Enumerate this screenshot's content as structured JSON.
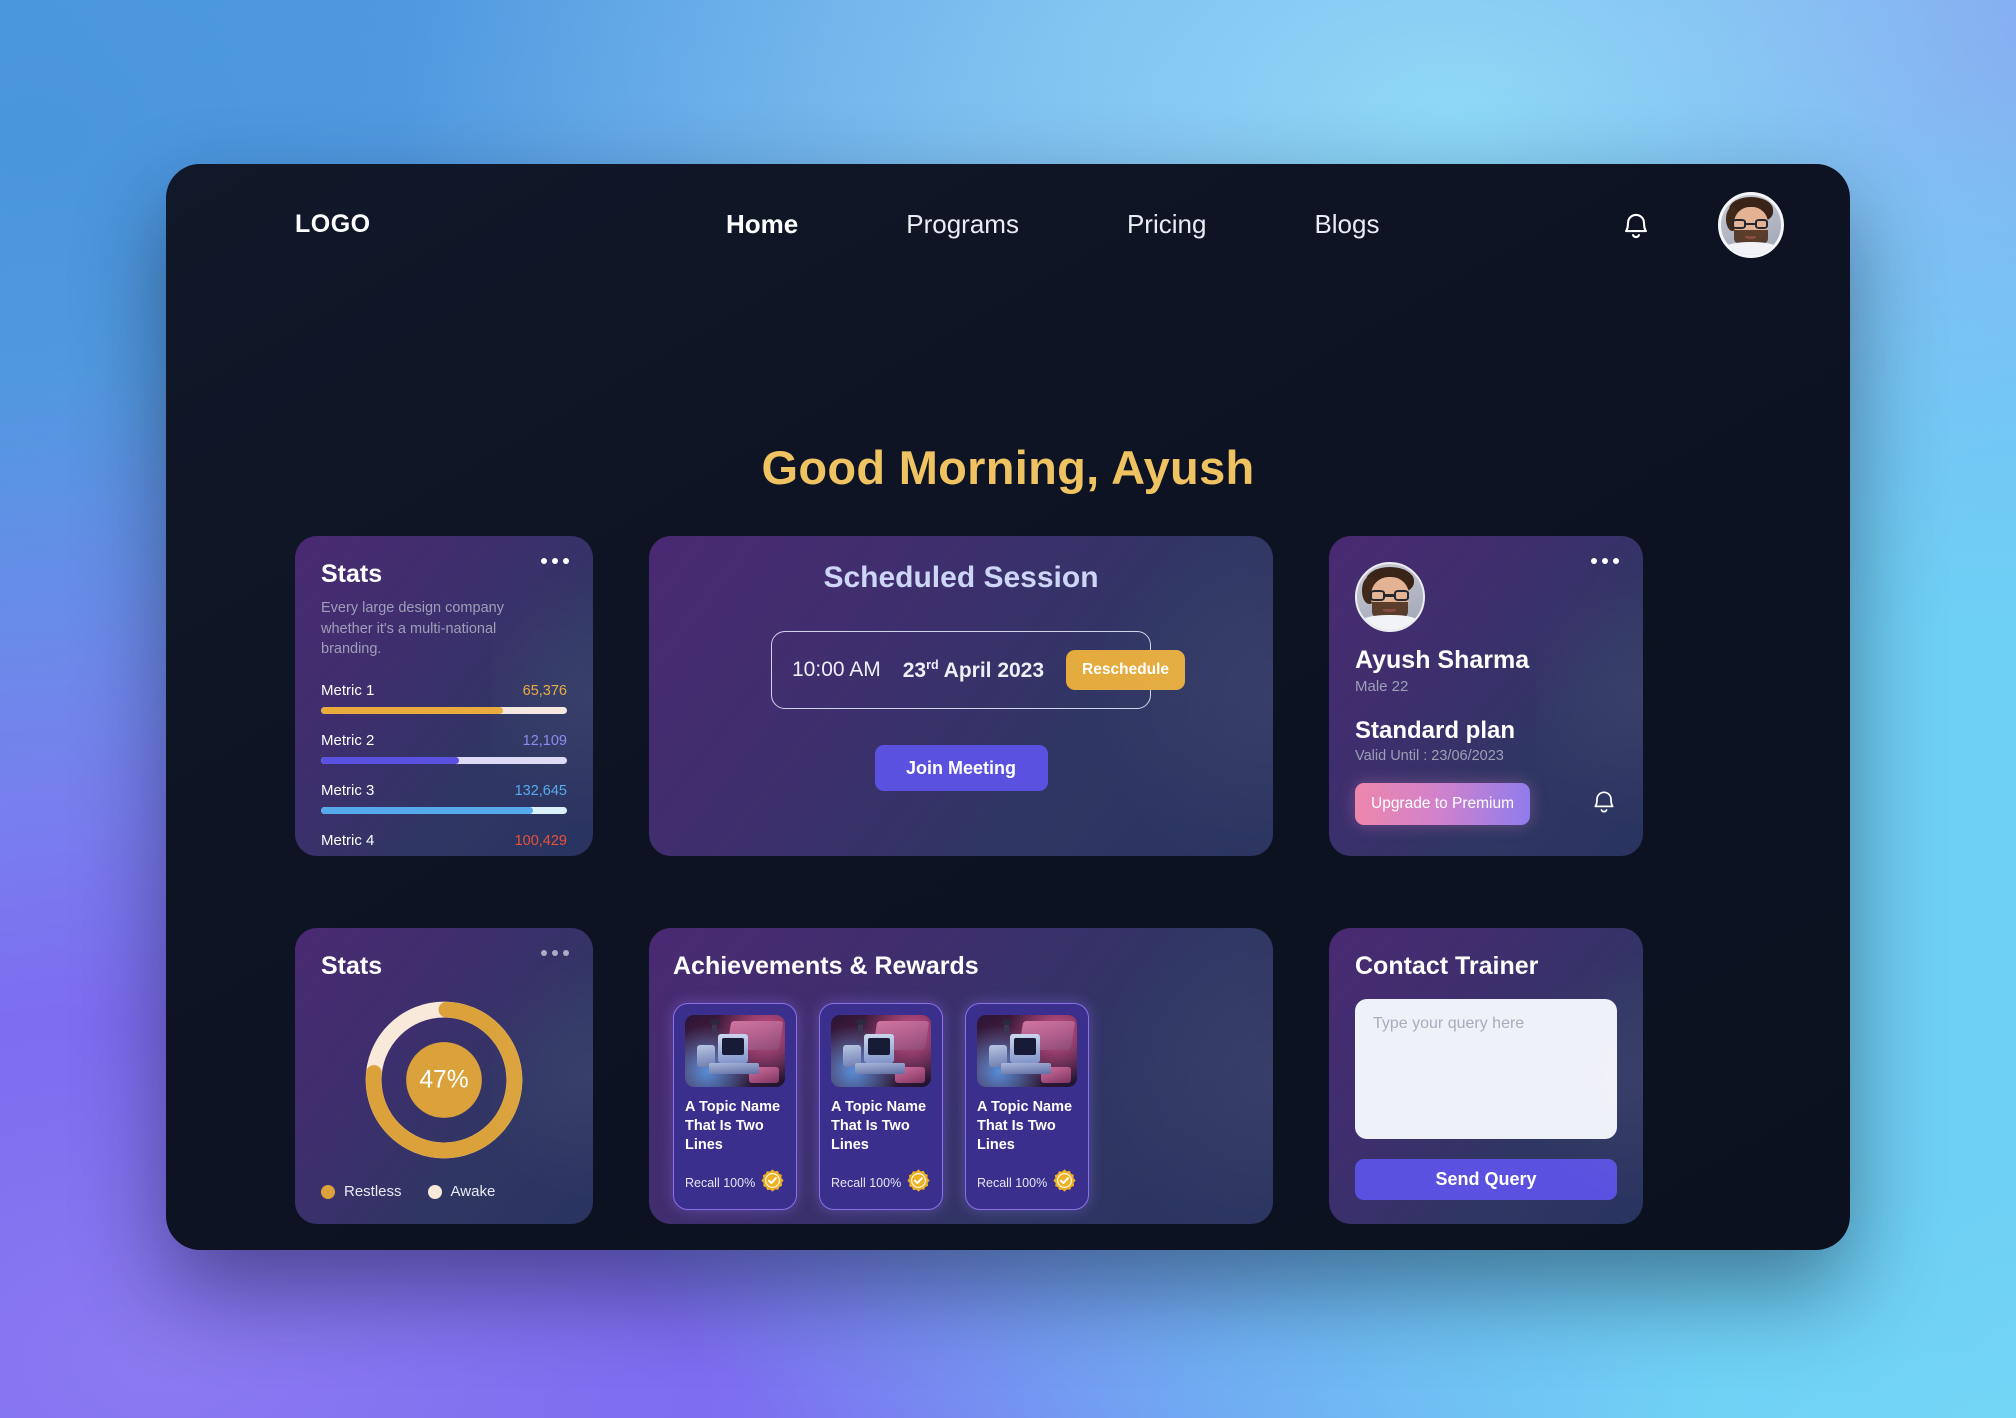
{
  "nav": {
    "logo": "LOGO",
    "links": [
      {
        "label": "Home",
        "active": true
      },
      {
        "label": "Programs",
        "active": false
      },
      {
        "label": "Pricing",
        "active": false
      },
      {
        "label": "Blogs",
        "active": false
      }
    ],
    "bell_icon": "bell-icon",
    "avatar_icon": "user-avatar"
  },
  "greeting": "Good Morning, Ayush",
  "stats_card": {
    "title": "Stats",
    "subtitle": "Every large design company whether it's a multi-national branding.",
    "menu_icon": "more-options-icon"
  },
  "session_card": {
    "title": "Scheduled Session",
    "time": "10:00 AM",
    "date_number": "23",
    "date_suffix": "rd",
    "date_rest": " April 2023",
    "reschedule_label": "Reschedule",
    "join_label": "Join Meeting"
  },
  "profile_card": {
    "name": "Ayush Sharma",
    "meta": "Male 22",
    "plan": "Standard plan",
    "valid_until": "Valid Until : 23/06/2023",
    "upgrade_label": "Upgrade to Premium",
    "menu_icon": "more-options-icon",
    "bell_icon": "bell-icon"
  },
  "donut_card": {
    "title": "Stats",
    "center_label": "47%",
    "menu_icon": "more-options-icon"
  },
  "achievements_card": {
    "title": "Achievements & Rewards",
    "items": [
      {
        "name": "A Topic Name That Is Two Lines",
        "recall": "Recall 100%",
        "badge_icon": "verified-badge-icon"
      },
      {
        "name": "A Topic Name That Is Two Lines",
        "recall": "Recall 100%",
        "badge_icon": "verified-badge-icon"
      },
      {
        "name": "A Topic Name That Is Two Lines",
        "recall": "Recall 100%",
        "badge_icon": "verified-badge-icon"
      }
    ],
    "scroll_percent": 46
  },
  "contact_card": {
    "title": "Contact Trainer",
    "query_placeholder": "Type your query here",
    "query_value": "",
    "send_label": "Send Query"
  },
  "colors": {
    "gold": "#e4ab3e",
    "greeting_gold": "#f0c362",
    "indigo": "#5a51e0",
    "blue": "#57a9ee",
    "red": "#e8503a",
    "cream": "#f7e6d9",
    "panel_dark": "#0d1322"
  },
  "chart_data": [
    {
      "type": "bar",
      "title": "Stats",
      "orientation": "horizontal",
      "categories": [
        "Metric 1",
        "Metric 2",
        "Metric 3",
        "Metric 4"
      ],
      "values": [
        65376,
        12109,
        132645,
        100429
      ],
      "value_labels": [
        "65,376",
        "12,109",
        "132,645",
        "100,429"
      ],
      "fill_percent": [
        74,
        56,
        86,
        63
      ],
      "series_colors": [
        "#e8ab3c",
        "#5a51e0",
        "#57a9ee",
        "#e8503a"
      ],
      "track_colors": [
        "#f4e7e0",
        "#ded9f6",
        "#daf0fb",
        "#f4e7e0"
      ],
      "grid": false,
      "legend": "none"
    },
    {
      "type": "pie",
      "subtype": "donut",
      "title": "Stats",
      "center_label": "47%",
      "labels": [
        "Restless",
        "Awake"
      ],
      "values": [
        76,
        24
      ],
      "colors": [
        "#dba23b",
        "#f9e9da"
      ],
      "start_angle_deg": -3,
      "legend": "bottom-left"
    }
  ]
}
